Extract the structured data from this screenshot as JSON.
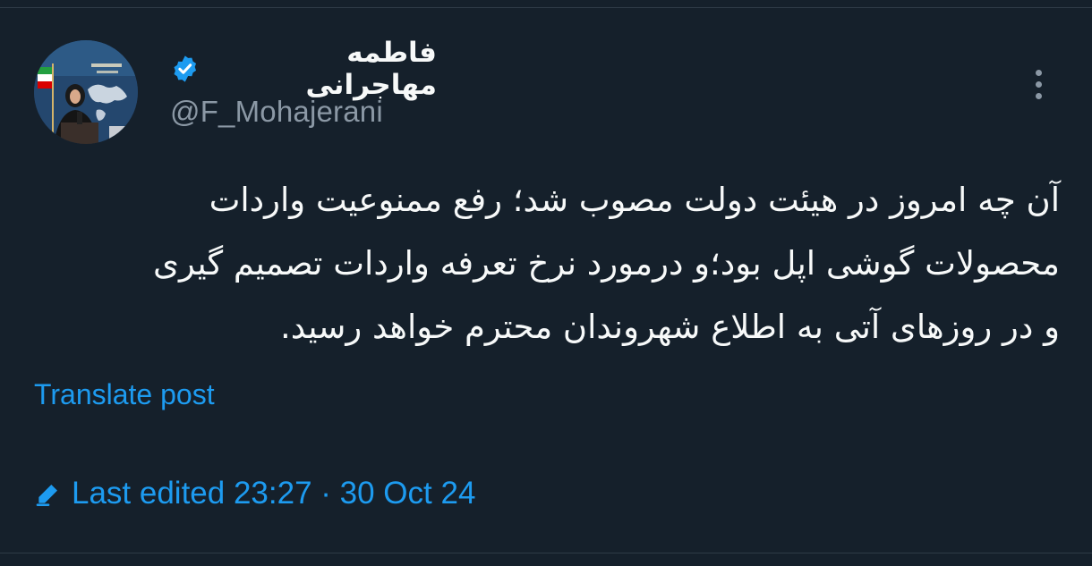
{
  "tweet": {
    "author": {
      "display_name": "فاطمه مهاجرانی",
      "handle": "@F_Mohajerani",
      "verified": true,
      "verified_icon": "verified-badge-icon",
      "avatar_icon": "profile-photo-avatar"
    },
    "text_lines": [
      "آن چه امروز در هیئت دولت مصوب شد؛ رفع ممنوعیت واردات",
      "محصولات گوشی اپل بود؛و درمورد نرخ تعرفه واردات تصمیم گیری",
      "و در روزهای آتی به اطلاع شهروندان محترم خواهد رسید."
    ],
    "translate_label": "Translate post",
    "edited_label": "Last edited 23:27 · 30 Oct 24",
    "more_icon": "more-options-icon"
  },
  "colors": {
    "background": "#15202b",
    "text": "#f7f9f9",
    "secondary_text": "#8b98a5",
    "accent": "#1d9bf0"
  }
}
